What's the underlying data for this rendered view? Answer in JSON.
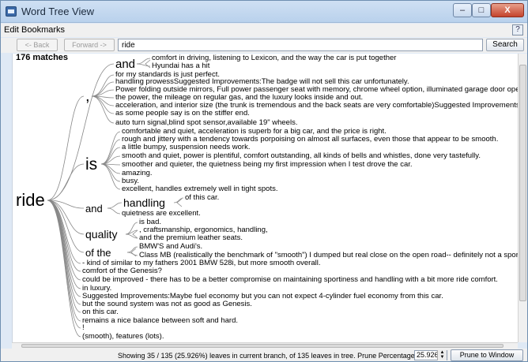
{
  "window": {
    "title": "Word Tree View",
    "minimize_glyph": "–",
    "maximize_glyph": "□",
    "close_glyph": "X",
    "icon": "app-icon"
  },
  "menu": {
    "items": [
      "Edit",
      "Bookmarks"
    ],
    "right_icon": "help-icon",
    "right_glyph": "?"
  },
  "toolbar": {
    "back_label": "<- Back",
    "forward_label": "Forward ->",
    "search_value": "ride",
    "search_button": "Search"
  },
  "tree": {
    "match_count": "176 matches",
    "root": "ride",
    "nodes": [
      {
        "text": "and",
        "fs": 15
      },
      {
        "text": ",",
        "fs": 20
      },
      {
        "text": "is",
        "fs": 21
      },
      {
        "text": "and",
        "fs": 13
      },
      {
        "text": "handling",
        "fs": 14
      },
      {
        "text": "quality",
        "fs": 14
      },
      {
        "text": "of the",
        "fs": 13
      }
    ],
    "leaves": [
      "comfort in driving, listening to Lexicon, and the way the car is put together",
      "Hyundai has a hit",
      "for my standards is just perfect.",
      "handling prowessSuggested Improvements:The badge will not sell this car unfortunately.",
      "Power folding outside mirrors, Full power passenger seat with memory, chrome wheel option, illuminated garage door opener, etc.",
      "the power, the mileage on regular gas, and the luxury looks inside and out.",
      "acceleration, and interior size (the trunk is tremendous and the back seats are very comfortable)Suggested Improvements:",
      "as some people say is on the stiffer end.",
      "auto turn signal,blind spot sensor,available 19\" wheels.",
      "comfortable and quiet, acceleration is superb for a big car, and the price is right.",
      "rough and jittery with a tendency towards porpoising on almost all surfaces, even those that appear to be smooth.",
      "a little bumpy, suspension needs work.",
      "smooth and quiet, power is plentiful, comfort outstanding, all kinds of bells and whistles, done very tastefully.",
      "smoother and quieter, the quietness being my first impression when I test drove the car.",
      "amazing.",
      "busy.",
      "excellent, handles extremely well in tight spots.",
      "of this car.",
      "quietness are excellent.",
      "is bad.",
      ", craftsmanship, ergonomics, handling,",
      "and the premium leather seats.",
      "BMW'S and Audi's.",
      "Class MB (realistically the benchmark of \"smooth\") I dumped but real close on the open road-- definitely not a sports sedan.",
      "- kind of similar to my fathers 2001 BMW 528i, but more smooth overall.",
      "comfort of the Genesis?",
      "could be improved - there has to be a better compromise on maintaining sportiness and handling with a bit more ride comfort.",
      "in luxury.",
      "Suggested Improvements:Maybe fuel economy but you can not expect 4-cylinder fuel economy from this car.",
      "but the sound system was not as good as Genesis.",
      "on this car.",
      "remains a nice balance between soft and hard.",
      "!",
      "(smooth), features (lots)."
    ]
  },
  "status": {
    "text": "Showing 35 / 135 (25.926%) leaves in current branch, of 135 leaves in tree.   Prune Percentage:",
    "prune_value": "25.926",
    "prune_button": "Prune to Window"
  }
}
